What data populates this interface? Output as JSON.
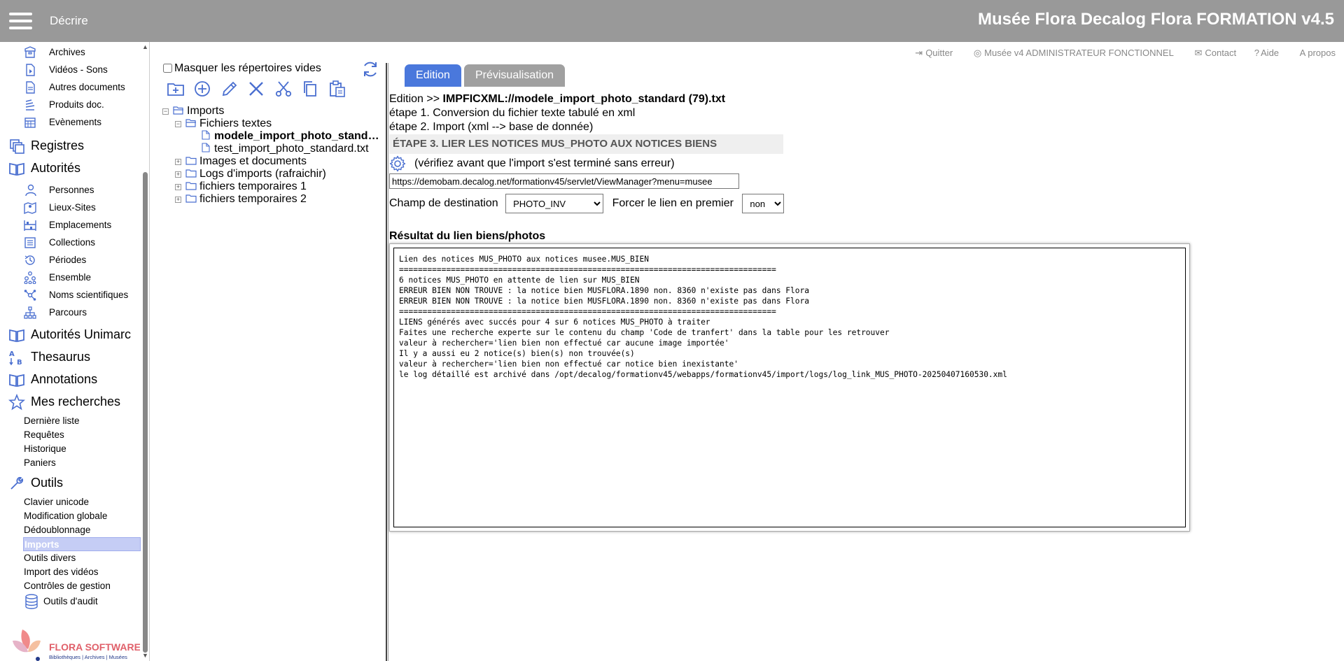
{
  "header": {
    "menu_label": "Décrire",
    "title": "Musée Flora Decalog Flora FORMATION v4.5"
  },
  "sidebar": {
    "items": [
      {
        "label": "Archives",
        "icon": "archive-box-icon"
      },
      {
        "label": "Vidéos - Sons",
        "icon": "media-file-icon"
      },
      {
        "label": "Autres documents",
        "icon": "document-icon"
      },
      {
        "label": "Produits doc.",
        "icon": "stack-icon"
      },
      {
        "label": "Evènements",
        "icon": "calendar-icon"
      }
    ],
    "cat_registres": "Registres",
    "cat_autorites": "Autorités",
    "autorites_items": [
      {
        "label": "Personnes",
        "icon": "persons-icon"
      },
      {
        "label": "Lieux-Sites",
        "icon": "map-icon"
      },
      {
        "label": "Emplacements",
        "icon": "shelves-icon"
      },
      {
        "label": "Collections",
        "icon": "collection-icon"
      },
      {
        "label": "Périodes",
        "icon": "history-icon"
      },
      {
        "label": "Ensemble",
        "icon": "hierarchy-icon"
      },
      {
        "label": "Noms scientifiques",
        "icon": "molecule-icon"
      },
      {
        "label": "Parcours",
        "icon": "tree-icon"
      }
    ],
    "cat_autorites_unimarc": "Autorités Unimarc",
    "cat_thesaurus": "Thesaurus",
    "cat_annotations": "Annotations",
    "cat_mes_recherches": "Mes recherches",
    "recherches_links": [
      "Dernière liste",
      "Requêtes",
      "Historique",
      "Paniers"
    ],
    "cat_outils": "Outils",
    "outils_links": [
      "Clavier unicode",
      "Modification globale",
      "Dédoublonnage",
      "Imports",
      "Outils divers",
      "Import des vidéos",
      "Contrôles de gestion"
    ],
    "outils_active": "Imports",
    "audit_label": "Outils d'audit",
    "logo_name": "FLORA SOFTWARE",
    "logo_tagline": "Bibliothèques | Archives | Musées"
  },
  "utilbar": {
    "quit": "Quitter",
    "user": "Musée v4 ADMINISTRATEUR FONCTIONNEL",
    "contact": "Contact",
    "help": "Aide",
    "about": "A propos"
  },
  "tree": {
    "mask_label": "Masquer les répertoires vides",
    "root": "Imports",
    "fichiers_textes": "Fichiers textes",
    "file_selected": "modele_import_photo_standard (79).txt",
    "file_other": "test_import_photo_standard.txt",
    "images_docs": "Images et documents",
    "logs": "Logs d'imports (rafraichir)",
    "temp1": "fichiers temporaires 1",
    "temp2": "fichiers temporaires 2"
  },
  "main": {
    "tab_edition": "Edition",
    "tab_preview": "Prévisualisation",
    "breadcrumb_prefix": "Edition >> ",
    "breadcrumb_file": "IMPFICXML://modele_import_photo_standard (79).txt",
    "step1": "étape 1. Conversion du fichier texte tabulé en xml",
    "step2": "étape 2. Import (xml --> base de donnée)",
    "step3": "ÉTAPE 3. LIER LES NOTICES MUS_PHOTO AUX NOTICES BIENS",
    "verify_text": "(vérifiez avant que l'import s'est terminé sans erreur)",
    "url_value": "https://demobam.decalog.net/formationv45/servlet/ViewManager?menu=musee",
    "dest_label": "Champ de destination",
    "dest_value": "PHOTO_INV",
    "force_label": "Forcer le lien en premier",
    "force_value": "non",
    "result_label": "Résultat du lien biens/photos",
    "result_lines": [
      "Lien des notices MUS_PHOTO aux notices musee.MUS_BIEN",
      "================================================================================",
      "6 notices MUS_PHOTO en attente de lien sur MUS_BIEN",
      "ERREUR BIEN NON TROUVE : la notice bien MUSFLORA.1890 non. 8360 n'existe pas dans Flora",
      "ERREUR BIEN NON TROUVE : la notice bien MUSFLORA.1890 non. 8360 n'existe pas dans Flora",
      "================================================================================",
      "LIENS générés avec succés pour 4 sur 6 notices MUS_PHOTO à traiter",
      "Faites une recherche experte sur le contenu du champ 'Code de tranfert' dans la table pour les retrouver",
      "valeur à rechercher='lien bien non effectué car aucune image importée'",
      "Il y a aussi eu 2 notice(s) bien(s) non trouvée(s)",
      "valeur à rechercher='lien bien non effectué car notice bien inexistante'",
      "le log détaillé est archivé dans /opt/decalog/formationv45/webapps/formationv45/import/logs/log_link_MUS_PHOTO-20250407160530.xml"
    ]
  },
  "colors": {
    "header_bg": "#999999",
    "icon_blue": "#4a6fd0",
    "tab_active": "#4a78dc",
    "tab_inactive": "#a0a0a0",
    "highlight": "#c5cdf5"
  }
}
